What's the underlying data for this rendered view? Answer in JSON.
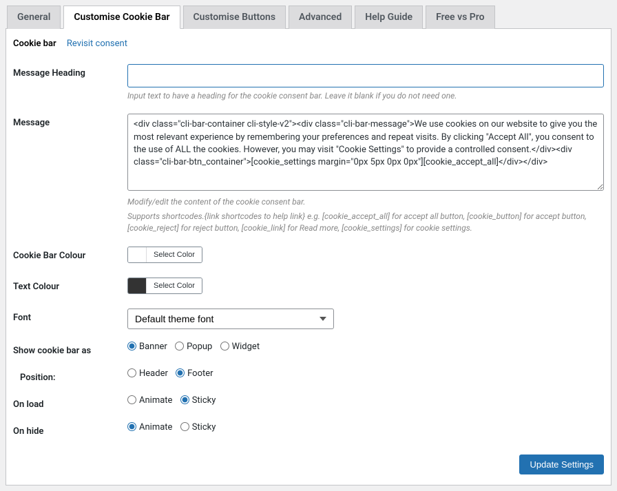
{
  "tabs": {
    "general": "General",
    "customise_cookie_bar": "Customise Cookie Bar",
    "customise_buttons": "Customise Buttons",
    "advanced": "Advanced",
    "help_guide": "Help Guide",
    "free_vs_pro": "Free vs Pro"
  },
  "subnav": {
    "cookie_bar": "Cookie bar",
    "revisit": "Revisit consent"
  },
  "fields": {
    "message_heading_label": "Message Heading",
    "message_heading_value": "",
    "message_heading_help": "Input text to have a heading for the cookie consent bar. Leave it blank if you do not need one.",
    "message_label": "Message",
    "message_value": "<div class=\"cli-bar-container cli-style-v2\"><div class=\"cli-bar-message\">We use cookies on our website to give you the most relevant experience by remembering your preferences and repeat visits. By clicking \"Accept All\", you consent to the use of ALL the cookies. However, you may visit \"Cookie Settings\" to provide a controlled consent.</div><div class=\"cli-bar-btn_container\">[cookie_settings margin=\"0px 5px 0px 0px\"][cookie_accept_all]</div></div>",
    "message_help1": "Modify/edit the content of the cookie consent bar.",
    "message_help2": "Supports shortcodes.{link shortcodes to help link} e.g. [cookie_accept_all] for accept all button, [cookie_button] for accept button, [cookie_reject] for reject button, [cookie_link] for Read more, [cookie_settings] for cookie settings.",
    "cookie_bar_colour_label": "Cookie Bar Colour",
    "text_colour_label": "Text Colour",
    "select_color": "Select Color",
    "font_label": "Font",
    "font_value": "Default theme font",
    "show_as_label": "Show cookie bar as",
    "show_as": {
      "banner": "Banner",
      "popup": "Popup",
      "widget": "Widget"
    },
    "position_label": "Position:",
    "position": {
      "header": "Header",
      "footer": "Footer"
    },
    "on_load_label": "On load",
    "on_hide_label": "On hide",
    "anim": {
      "animate": "Animate",
      "sticky": "Sticky"
    }
  },
  "submit": "Update Settings"
}
